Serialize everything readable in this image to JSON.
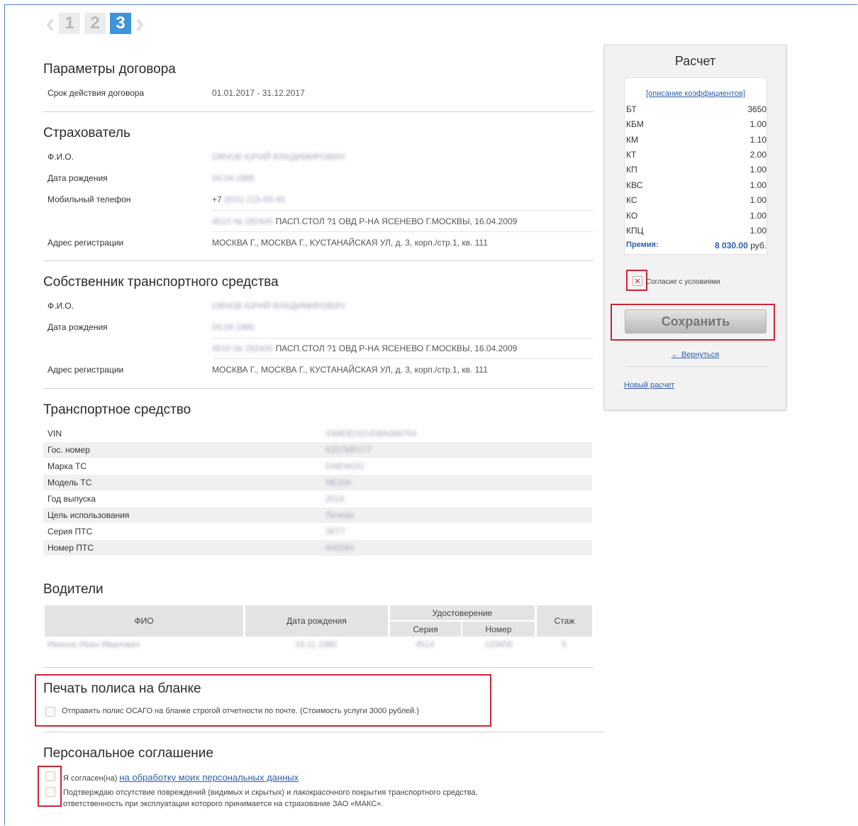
{
  "steps": {
    "items": [
      "1",
      "2",
      "3"
    ],
    "active": "3"
  },
  "contract": {
    "title": "Параметры договора",
    "term_label": "Срок действия договора",
    "term_value": "01.01.2017 - 31.12.2017"
  },
  "insurer": {
    "title": "Страхователь",
    "fio_label": "Ф.И.О.",
    "fio_value": "ОВЧОВ ЮРИЙ ВЛАДИМИРОВИЧ",
    "birth_label": "Дата рождения",
    "birth_value": "04.04.1985",
    "phone_label": "Мобильный телефон",
    "phone_prefix": "+7",
    "phone_value": "(915) 215-60-45",
    "passport_masked": "4510 № 282445",
    "passport_value": "ПАСП.СТОЛ ?1 ОВД Р-НА ЯСЕНЕВО Г.МОСКВЫ, 16.04.2009",
    "address_label": "Адрес регистрации",
    "address_value": "МОСКВА Г., МОСКВА Г., КУСТАНАЙСКАЯ УЛ, д. 3, корп./стр.1, кв. 111"
  },
  "owner": {
    "title": "Собственник транспортного средства",
    "fio_label": "Ф.И.О.",
    "fio_value": "ОВЧОВ ЮРИЙ ВЛАДИМИРОВИЧ",
    "birth_label": "Дата рождения",
    "birth_value": "04.04.1985",
    "passport_masked": "4510 № 282445",
    "passport_value": "ПАСП.СТОЛ ?1 ОВД Р-НА ЯСЕНЕВО Г.МОСКВЫ, 16.04.2009",
    "address_label": "Адрес регистрации",
    "address_value": "МОСКВА Г., МОСКВА Г., КУСТАНАЙСКАЯ УЛ, д. 3, корп./стр.1, кв. 111"
  },
  "vehicle": {
    "title": "Транспортное средство",
    "rows": [
      {
        "label": "VIN",
        "value": "XWB3D31UD8A089754"
      },
      {
        "label": "Гос. номер",
        "value": "К207МР177"
      },
      {
        "label": "Марка ТС",
        "value": "DAEWOO"
      },
      {
        "label": "Модель ТС",
        "value": "NEXIA"
      },
      {
        "label": "Год выпуска",
        "value": "2016"
      },
      {
        "label": "Цель использования",
        "value": "Личная"
      },
      {
        "label": "Серия ПТС",
        "value": "36ТТ"
      },
      {
        "label": "Номер ПТС",
        "value": "446284"
      }
    ]
  },
  "drivers": {
    "title": "Водители",
    "headers": {
      "fio": "ФИО",
      "birth": "Дата рождения",
      "license": "Удостоверение",
      "series": "Серия",
      "number": "Номер",
      "experience": "Стаж"
    },
    "rows": [
      {
        "fio": "Иванов Иван Иванович",
        "birth": "10.11.1980",
        "series": "4514",
        "number": "123456",
        "experience": "9"
      }
    ]
  },
  "print": {
    "title": "Печать полиса на бланке",
    "checkbox_label": "Отправить полис ОСАГО на бланке строгой отчетности по почте. (Стоимость услуги 3000 рублей.)"
  },
  "agreement": {
    "title": "Персональное соглашение",
    "consent_prefix": "Я согласен(на)",
    "consent_link": "на обработку моих персональных данных",
    "confirm_line1": "Подтверждаю отсутствие повреждений (видимых и скрытых) и лакокрасочного покрытия транспортного средства,",
    "confirm_line2": "ответственность при эксплуатации которого принимается на страхование ЗАО «МАКС»."
  },
  "calc": {
    "title": "Расчет",
    "coef_link": "[описание коэффициентов]",
    "coefficients": [
      {
        "name": "БТ",
        "value": "3650"
      },
      {
        "name": "КБМ",
        "value": "1.00"
      },
      {
        "name": "КМ",
        "value": "1.10"
      },
      {
        "name": "КТ",
        "value": "2.00"
      },
      {
        "name": "КП",
        "value": "1.00"
      },
      {
        "name": "КВС",
        "value": "1.00"
      },
      {
        "name": "КС",
        "value": "1.00"
      },
      {
        "name": "КО",
        "value": "1.00"
      },
      {
        "name": "КПЦ",
        "value": "1.00"
      }
    ],
    "premium_label": "Премия:",
    "premium_value": "8 030.00",
    "premium_currency": "руб.",
    "agree_label": "Согласие с условиями",
    "save_label": "Сохранить",
    "back_label": "← Вернуться",
    "new_calc_label": "Новый расчет"
  },
  "colors": {
    "accent": "#3f93d8",
    "link": "#2d5ea8",
    "highlight": "#d02437"
  }
}
